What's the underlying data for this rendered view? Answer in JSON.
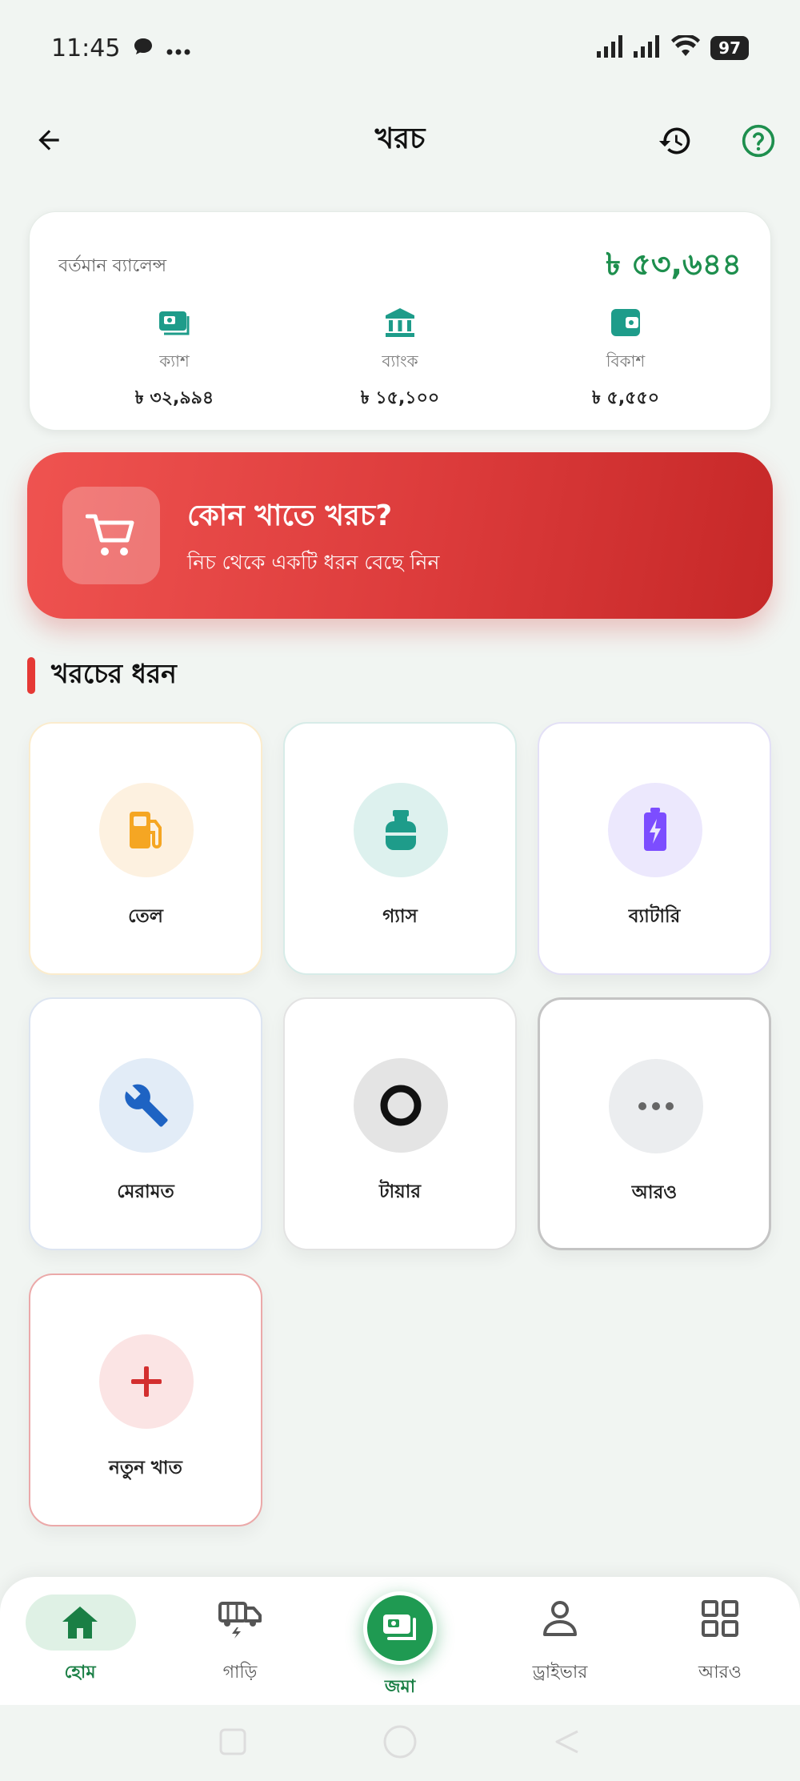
{
  "status_bar": {
    "time": "11:45",
    "battery": "97"
  },
  "header": {
    "title": "খরচ"
  },
  "balance": {
    "label": "বর্তমান ব্যালেন্স",
    "total": "৳ ৫৩,৬৪৪",
    "accounts": [
      {
        "name": "ক্যাশ",
        "amount": "৳ ৩২,৯৯৪",
        "icon": "cash-icon"
      },
      {
        "name": "ব্যাংক",
        "amount": "৳ ১৫,১০০",
        "icon": "bank-icon"
      },
      {
        "name": "বিকাশ",
        "amount": "৳ ৫,৫৫০",
        "icon": "wallet-icon"
      }
    ]
  },
  "banner": {
    "title": "কোন খাতে খরচ?",
    "subtitle": "নিচ থেকে একটি ধরন বেছে নিন",
    "icon": "cart-icon"
  },
  "section": {
    "title": "খরচের ধরন"
  },
  "categories": [
    {
      "label": "তেল",
      "icon": "fuel-icon",
      "color": "#f5a623",
      "bg": "#fdf1e0"
    },
    {
      "label": "গ্যাস",
      "icon": "gas-cylinder-icon",
      "color": "#1e9c8a",
      "bg": "#ddf1ee"
    },
    {
      "label": "ব্যাটারি",
      "icon": "battery-icon",
      "color": "#7c4dff",
      "bg": "#ece8fd"
    },
    {
      "label": "মেরামত",
      "icon": "wrench-icon",
      "color": "#1e63c3",
      "bg": "#e2ecf7"
    },
    {
      "label": "টায়ার",
      "icon": "tire-icon",
      "color": "#111111",
      "bg": "#e4e4e4"
    },
    {
      "label": "আরও",
      "icon": "more-dots-icon",
      "color": "#666666",
      "bg": "#ebedef"
    },
    {
      "label": "নতুন খাত",
      "icon": "plus-icon",
      "color": "#d32f2f",
      "bg": "#fbe4e4"
    }
  ],
  "bottom_nav": [
    {
      "label": "হোম",
      "icon": "home-icon"
    },
    {
      "label": "গাড়ি",
      "icon": "vehicle-icon"
    },
    {
      "label": "জমা",
      "icon": "deposit-icon"
    },
    {
      "label": "ড্রাইভার",
      "icon": "driver-icon"
    },
    {
      "label": "আরও",
      "icon": "grid-icon"
    }
  ],
  "colors": {
    "brand_green": "#1e8f4e",
    "accent_red": "#e53935"
  }
}
